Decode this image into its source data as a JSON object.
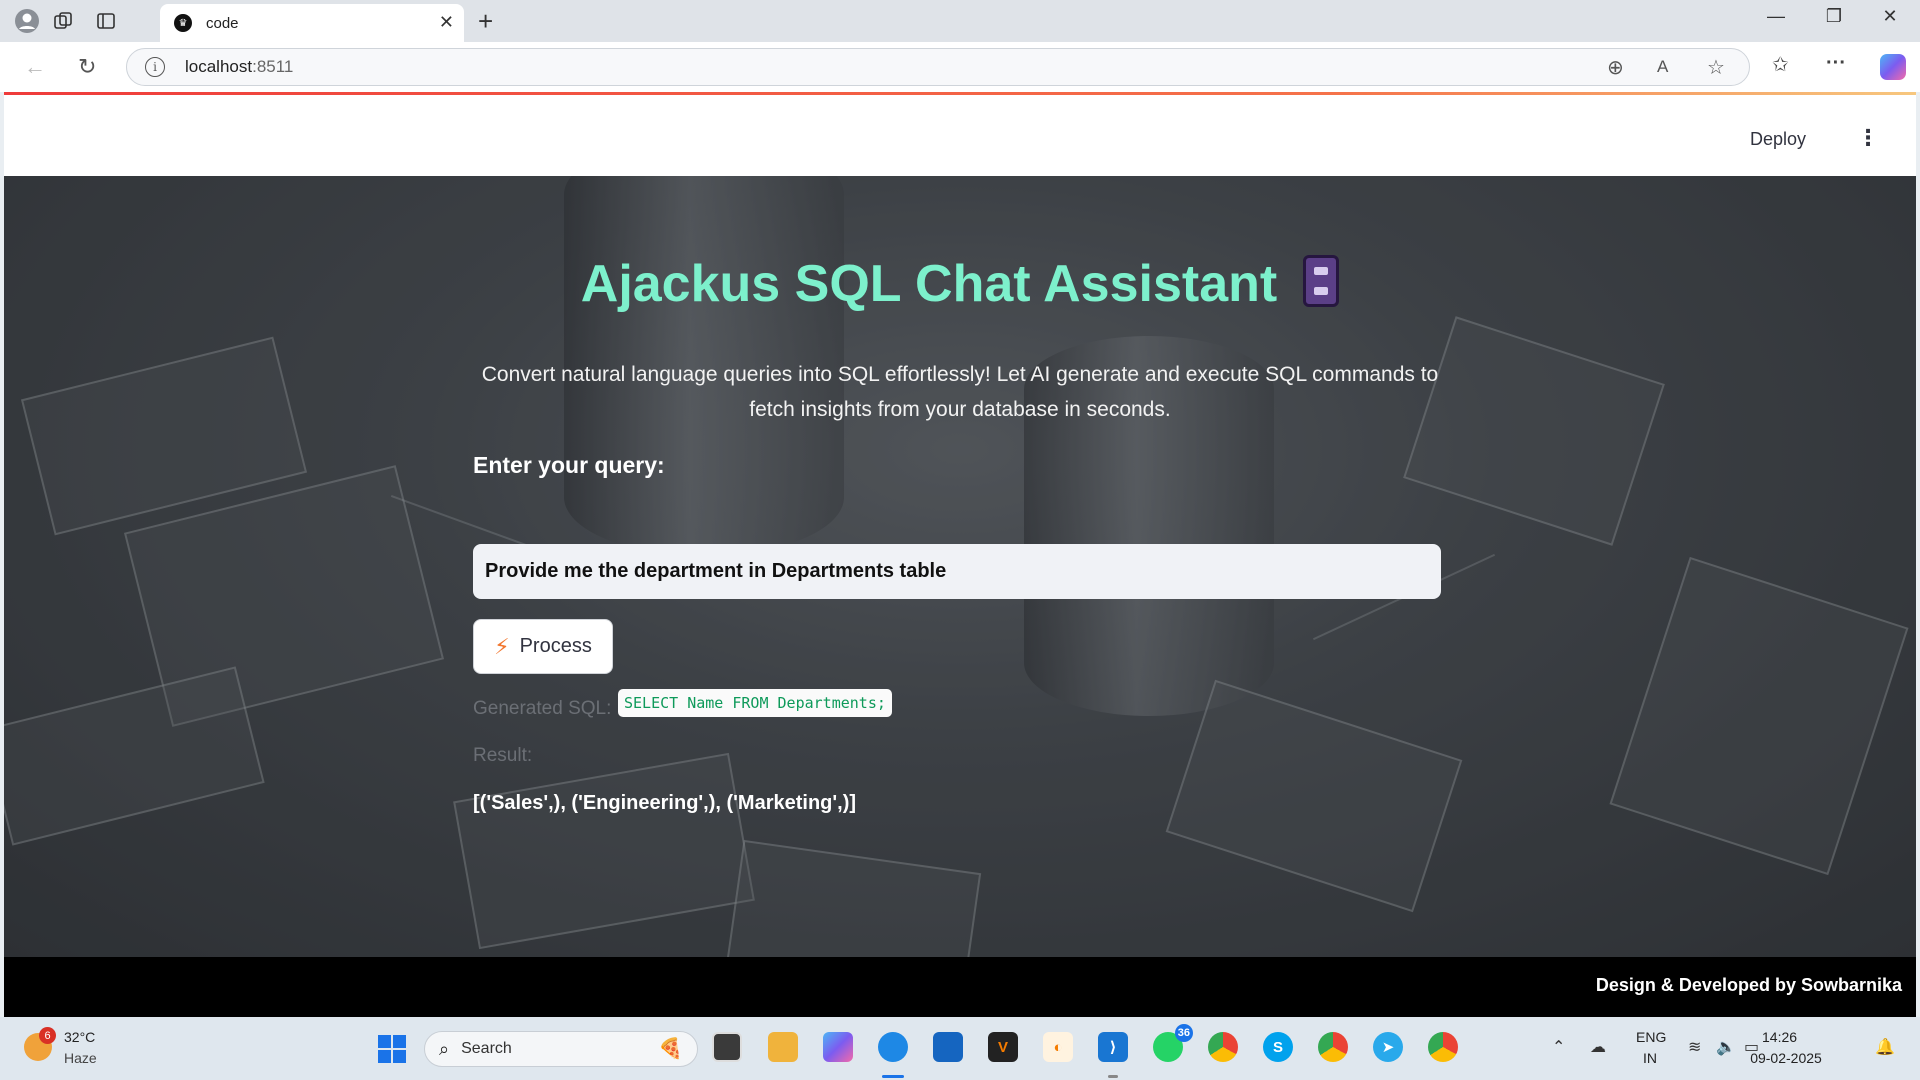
{
  "browser": {
    "tab_title": "code",
    "url_host": "localhost",
    "url_port": ":8511"
  },
  "app": {
    "deploy_label": "Deploy",
    "title": "Ajackus SQL Chat Assistant",
    "subtitle": "Convert natural language queries into SQL effortlessly! Let AI generate and execute SQL commands to fetch insights from your database in seconds.",
    "query_label": "Enter your query:",
    "query_value": "Provide me the department  in Departments table",
    "process_label": "Process",
    "generated_label": "Generated SQL:",
    "generated_sql": "SELECT Name FROM Departments;",
    "result_label": "Result:",
    "result_value": "[('Sales',), ('Engineering',), ('Marketing',)]",
    "footer_text": "Design & Developed by Sowbarnika",
    "accent_color": "#7df0cc"
  },
  "taskbar": {
    "weather_badge": "6",
    "temperature": "32°C",
    "weather": "Haze",
    "search_label": "Search",
    "whatsapp_badge": "36",
    "lang_line1": "ENG",
    "lang_line2": "IN",
    "time": "14:26",
    "date": "09-02-2025"
  }
}
